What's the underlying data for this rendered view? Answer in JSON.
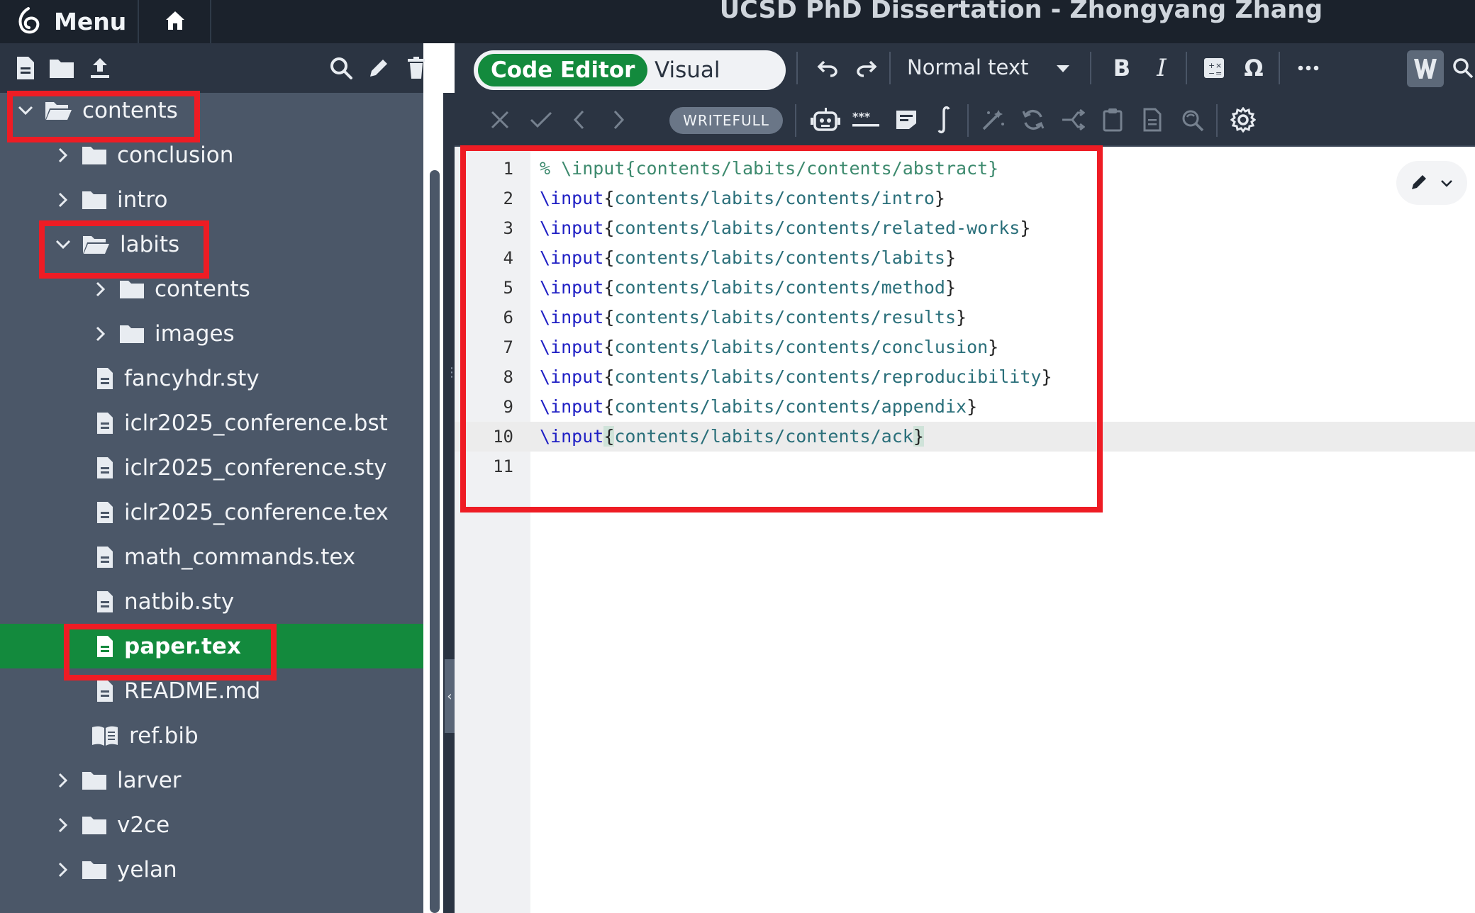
{
  "app": {
    "menu_label": "Menu",
    "project_title": "UCSD PhD Dissertation - Zhongyang Zhang"
  },
  "editor_toolbar": {
    "code_editor_label": "Code Editor",
    "visual_editor_label": "Visual Editor",
    "text_style_label": "Normal text",
    "writefull_label": "WRITEFULL"
  },
  "file_tree": {
    "rows": [
      {
        "label": "contents",
        "type": "folder-open"
      },
      {
        "label": "conclusion",
        "type": "folder"
      },
      {
        "label": "intro",
        "type": "folder"
      },
      {
        "label": "labits",
        "type": "folder-open"
      },
      {
        "label": "contents",
        "type": "folder"
      },
      {
        "label": "images",
        "type": "folder"
      },
      {
        "label": "fancyhdr.sty",
        "type": "file"
      },
      {
        "label": "iclr2025_conference.bst",
        "type": "file"
      },
      {
        "label": "iclr2025_conference.sty",
        "type": "file"
      },
      {
        "label": "iclr2025_conference.tex",
        "type": "file"
      },
      {
        "label": "math_commands.tex",
        "type": "file"
      },
      {
        "label": "natbib.sty",
        "type": "file"
      },
      {
        "label": "paper.tex",
        "type": "file",
        "selected": true
      },
      {
        "label": "README.md",
        "type": "file"
      },
      {
        "label": "ref.bib",
        "type": "bib"
      },
      {
        "label": "larver",
        "type": "folder"
      },
      {
        "label": "v2ce",
        "type": "folder"
      },
      {
        "label": "yelan",
        "type": "folder"
      }
    ]
  },
  "code": {
    "line_numbers": [
      "1",
      "2",
      "3",
      "4",
      "5",
      "6",
      "7",
      "8",
      "9",
      "10",
      "11"
    ],
    "comment_line": "% \\input{contents/labits/contents/abstract}",
    "command": "\\input",
    "open_brace": "{",
    "close_brace": "}",
    "args": [
      "contents/labits/contents/intro",
      "contents/labits/contents/related-works",
      "contents/labits/contents/labits",
      "contents/labits/contents/method",
      "contents/labits/contents/results",
      "contents/labits/contents/conclusion",
      "contents/labits/contents/reproducibility",
      "contents/labits/contents/appendix",
      "contents/labits/contents/ack"
    ]
  },
  "colors": {
    "accent_green": "#138a3d",
    "sidebar_bg": "#4b5768",
    "toolbar_bg": "#2b3442",
    "annotation_red": "#ee1c24"
  }
}
